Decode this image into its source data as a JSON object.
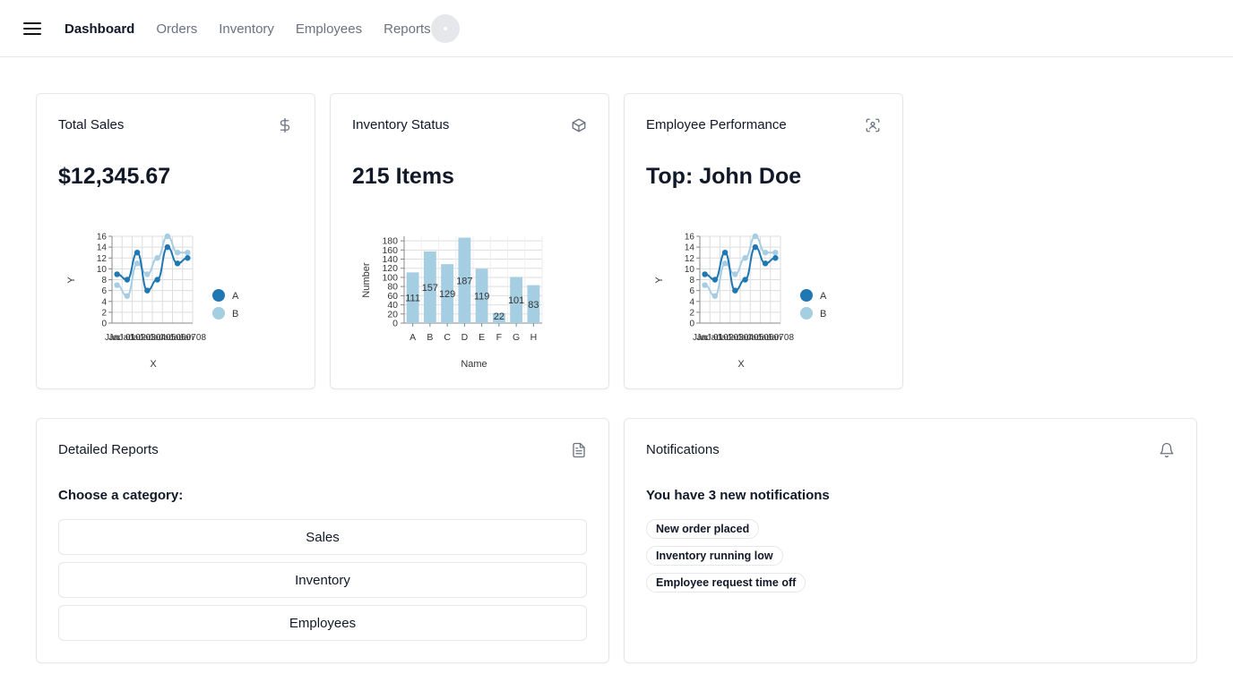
{
  "nav": {
    "items": [
      {
        "label": "Dashboard",
        "active": true
      },
      {
        "label": "Orders",
        "active": false
      },
      {
        "label": "Inventory",
        "active": false
      },
      {
        "label": "Employees",
        "active": false
      },
      {
        "label": "Reports",
        "active": false
      }
    ]
  },
  "cards": {
    "sales": {
      "title": "Total Sales",
      "value": "$12,345.67",
      "icon": "dollar-icon"
    },
    "inventory": {
      "title": "Inventory Status",
      "value": "215 Items",
      "icon": "box-icon"
    },
    "employee": {
      "title": "Employee Performance",
      "value": "Top: John Doe",
      "icon": "scan-face-icon"
    }
  },
  "reports": {
    "title": "Detailed Reports",
    "icon": "file-text-icon",
    "prompt": "Choose a category:",
    "categories": [
      "Sales",
      "Inventory",
      "Employees"
    ]
  },
  "notifications": {
    "title": "Notifications",
    "icon": "bell-icon",
    "summary": "You have 3 new notifications",
    "items": [
      "New order placed",
      "Inventory running low",
      "Employee request time off"
    ]
  },
  "chart_data": [
    {
      "type": "line",
      "card": "sales",
      "xlabel": "X",
      "ylabel": "Y",
      "x_ticks": [
        "Jan",
        "Jan 01",
        "Jan 02",
        "Jan 03",
        "Jan 04",
        "Jan 05",
        "Jan 06",
        "Jan 07",
        "Jan 08"
      ],
      "ylim": [
        0,
        16
      ],
      "y_ticks": [
        0,
        2,
        4,
        6,
        8,
        10,
        12,
        14,
        16
      ],
      "grid": true,
      "legend": "right",
      "series": [
        {
          "name": "A",
          "color": "#1f77b4",
          "values": [
            9,
            8,
            13,
            6,
            8,
            14,
            11,
            12
          ]
        },
        {
          "name": "B",
          "color": "#a6cee3",
          "values": [
            7,
            5,
            11,
            9,
            12,
            16,
            13,
            13
          ]
        }
      ]
    },
    {
      "type": "bar",
      "card": "inventory",
      "xlabel": "Name",
      "ylabel": "Number",
      "categories": [
        "A",
        "B",
        "C",
        "D",
        "E",
        "F",
        "G",
        "H"
      ],
      "values": [
        111,
        157,
        129,
        187,
        119,
        22,
        101,
        83
      ],
      "ylim": [
        0,
        190
      ],
      "y_ticks": [
        0,
        20,
        40,
        60,
        80,
        100,
        120,
        140,
        160,
        180
      ],
      "grid": true,
      "color": "#a6cee3"
    },
    {
      "type": "line",
      "card": "employee",
      "xlabel": "X",
      "ylabel": "Y",
      "x_ticks": [
        "Jan",
        "Jan 01",
        "Jan 02",
        "Jan 03",
        "Jan 04",
        "Jan 05",
        "Jan 06",
        "Jan 07",
        "Jan 08"
      ],
      "ylim": [
        0,
        16
      ],
      "y_ticks": [
        0,
        2,
        4,
        6,
        8,
        10,
        12,
        14,
        16
      ],
      "grid": true,
      "legend": "right",
      "series": [
        {
          "name": "A",
          "color": "#1f77b4",
          "values": [
            9,
            8,
            13,
            6,
            8,
            14,
            11,
            12
          ]
        },
        {
          "name": "B",
          "color": "#a6cee3",
          "values": [
            7,
            5,
            11,
            9,
            12,
            16,
            13,
            13
          ]
        }
      ]
    }
  ]
}
